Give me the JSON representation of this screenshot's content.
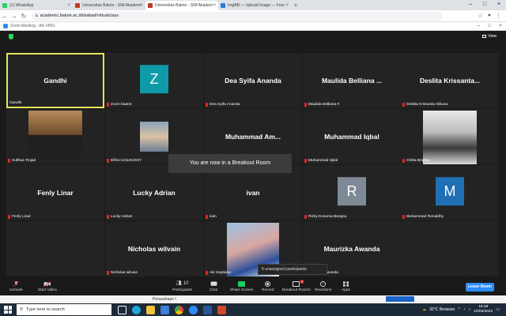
{
  "browser": {
    "tabs": [
      {
        "label": "(1) WhatsApp",
        "color": "#25d366"
      },
      {
        "label": "Universitas Bakrie - SIM Akademi",
        "color": "#c0392b"
      },
      {
        "label": "Universitas Bakrie - SIM Akadem",
        "color": "#c0392b",
        "active": true
      },
      {
        "label": "ImgBB — Upload Image — Free",
        "color": "#2a7ae2"
      }
    ],
    "new_tab": "+",
    "url": "academic.bakrie.ac.id/siakad/virtualclass"
  },
  "zoom": {
    "window_title": "Zoom Meeting - AK-VR61",
    "view_label": "View",
    "breakout_banner": "You are now in a Breakout Room",
    "popup_text": "5 unassigned participants",
    "participants_count": "10",
    "breakout_badge": "5",
    "tiles": [
      {
        "name": "Gandhi",
        "label": "Gandhi",
        "active": true
      },
      {
        "avatar": "Z",
        "avatar_color": "#0f9aa8",
        "label": "zoom baa04"
      },
      {
        "name": "Dea Syifa Ananda",
        "label": "Dea Syifa Ananda"
      },
      {
        "name": "Maulida  Belliana ...",
        "label": "Maulida Belliana F."
      },
      {
        "name": "Deslita  Krissanta...",
        "label": "Deslita Krissanta Sibuea"
      },
      {
        "photo": "sultan",
        "label": "Sulthan Rojad"
      },
      {
        "photo": "elfira",
        "label": "Elfira-1211910037"
      },
      {
        "name": "Muhammad  Am...",
        "label": ""
      },
      {
        "name": "Muhammad Iqbal",
        "label": "Muhammad Iqbal"
      },
      {
        "photo": "chitta",
        "label": "Chitta Brigitta"
      },
      {
        "name": "Fenly Linar",
        "label": "Fenly Linar"
      },
      {
        "name": "Lucky Adrian",
        "label": "Lucky Adrian"
      },
      {
        "name": "ivan",
        "label": "ivan"
      },
      {
        "avatar": "R",
        "avatar_color": "#7e8a95",
        "label": "Rizky Kesuma Bangsa"
      },
      {
        "avatar": "M",
        "avatar_color": "#1f6fb5",
        "label": "Muhammad Renaldhy"
      },
      {
        "name": "",
        "label": ""
      },
      {
        "name": "Nicholas wilvain",
        "label": "Nicholas wilvain"
      },
      {
        "photo": "aik",
        "label": "Aik Septiana"
      },
      {
        "name": "Maurizka Awanda",
        "label": "Maurizka Awanda"
      },
      {
        "name": "",
        "label": ""
      }
    ],
    "controls": {
      "unmute": "Unmute",
      "start_video": "Start Video",
      "participants": "Participants",
      "chat": "Chat",
      "share_screen": "Share Screen",
      "record": "Record",
      "breakout_rooms": "Breakout Rooms",
      "reactions": "Reactions",
      "apps": "Apps",
      "leave": "Leave Room"
    }
  },
  "page_below": {
    "text": "Perusahaan I"
  },
  "taskbar": {
    "search_placeholder": "Type here to search",
    "weather": "30°C  Berawan",
    "time": "18:39",
    "date": "10/05/2022"
  },
  "colors": {
    "accent": "#2d8cff",
    "speaker_border": "#e6e45a",
    "mic_muted": "#e02828"
  }
}
